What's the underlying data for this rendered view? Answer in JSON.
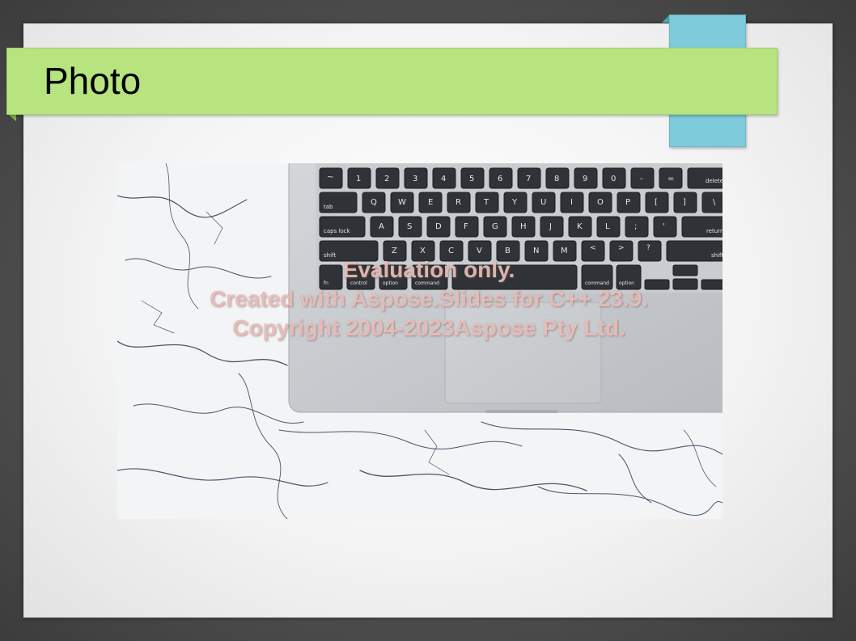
{
  "slide": {
    "title": "Photo"
  },
  "photo": {
    "icon": "laptop-on-marble-photo",
    "keyboard_row1": [
      "~",
      "1",
      "2",
      "3",
      "4",
      "5",
      "6",
      "7",
      "8",
      "9",
      "0",
      "-",
      "=",
      "delete"
    ],
    "keyboard_row2": [
      "tab",
      "Q",
      "W",
      "E",
      "R",
      "T",
      "Y",
      "U",
      "I",
      "O",
      "P",
      "[",
      "]",
      "\\"
    ],
    "keyboard_row3": [
      "caps lock",
      "A",
      "S",
      "D",
      "F",
      "G",
      "H",
      "J",
      "K",
      "L",
      ";",
      "'",
      "return"
    ],
    "keyboard_row4": [
      "shift",
      "Z",
      "X",
      "C",
      "V",
      "B",
      "N",
      "M",
      "<",
      ">",
      "?",
      "shift"
    ],
    "keyboard_row5": [
      "fn",
      "control",
      "option",
      "command",
      "command",
      "option"
    ]
  },
  "watermark": {
    "line1": "Evaluation only.",
    "line2": "Created with Aspose.Slides for C++ 23.9.",
    "line3": "Copyright 2004-2023Aspose Pty Ltd."
  },
  "colors": {
    "title_band": "#b7e47e",
    "blue_tab": "#7ecbdc",
    "background": "#4a4a4a"
  }
}
